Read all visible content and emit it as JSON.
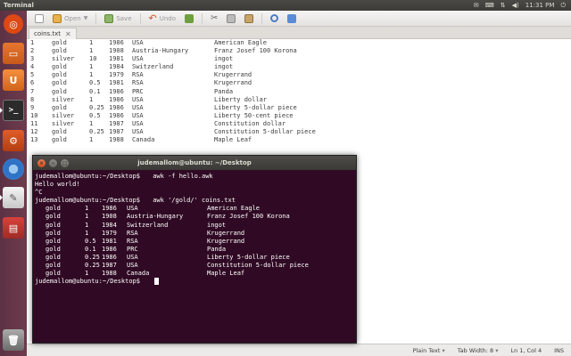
{
  "top_panel": {
    "app_title": "Terminal",
    "time": "11:31 PM"
  },
  "launcher": {
    "items": [
      "ubuntu-icon",
      "files-icon",
      "ubuntu-one-icon",
      "terminal-icon",
      "settings-icon",
      "chromium-icon",
      "gedit-icon",
      "impress-icon",
      "trash-icon"
    ]
  },
  "toolbar": {
    "open_label": "Open",
    "save_label": "Save",
    "undo_label": "Undo"
  },
  "tab": {
    "label": "coins.txt"
  },
  "editor_lines": [
    [
      "1",
      "gold",
      "1",
      "1986",
      "USA",
      "American Eagle"
    ],
    [
      "2",
      "gold",
      "1",
      "1908",
      "Austria-Hungary",
      "Franz Josef 100 Korona"
    ],
    [
      "3",
      "silver",
      "10",
      "1981",
      "USA",
      "ingot"
    ],
    [
      "4",
      "gold",
      "1",
      "1984",
      "Switzerland",
      "ingot"
    ],
    [
      "5",
      "gold",
      "1",
      "1979",
      "RSA",
      "Krugerrand"
    ],
    [
      "6",
      "gold",
      "0.5",
      "1981",
      "RSA",
      "Krugerrand"
    ],
    [
      "7",
      "gold",
      "0.1",
      "1986",
      "PRC",
      "Panda"
    ],
    [
      "8",
      "silver",
      "1",
      "1986",
      "USA",
      "Liberty dollar"
    ],
    [
      "9",
      "gold",
      "0.25",
      "1986",
      "USA",
      "Liberty 5-dollar piece"
    ],
    [
      "10",
      "silver",
      "0.5",
      "1986",
      "USA",
      "Liberty 50-cent piece"
    ],
    [
      "11",
      "silver",
      "1",
      "1987",
      "USA",
      "Constitution dollar"
    ],
    [
      "12",
      "gold",
      "0.25",
      "1987",
      "USA",
      "Constitution 5-dollar piece"
    ],
    [
      "13",
      "gold",
      "1",
      "1988",
      "Canada",
      "Maple Leaf"
    ]
  ],
  "statusbar": {
    "language": "Plain Text",
    "tab_width": "Tab Width: 8",
    "position": "Ln 1, Col 4",
    "mode": "INS"
  },
  "terminal": {
    "title": "judemallom@ubuntu: ~/Desktop",
    "prompt": "judemallom@ubuntu:~/Desktop$",
    "cmd1": " awk -f hello.awk",
    "out1": "Hello world!",
    "out2": "^C",
    "cmd2": " awk '/gold/' coins.txt",
    "results": [
      [
        "gold",
        "1",
        "1986",
        "USA",
        "American Eagle"
      ],
      [
        "gold",
        "1",
        "1908",
        "Austria-Hungary",
        "Franz Josef 100 Korona"
      ],
      [
        "gold",
        "1",
        "1984",
        "Switzerland",
        "ingot"
      ],
      [
        "gold",
        "1",
        "1979",
        "RSA",
        "Krugerrand"
      ],
      [
        "gold",
        "0.5",
        "1981",
        "RSA",
        "Krugerrand"
      ],
      [
        "gold",
        "0.1",
        "1986",
        "PRC",
        "Panda"
      ],
      [
        "gold",
        "0.25",
        "1986",
        "USA",
        "Liberty 5-dollar piece"
      ],
      [
        "gold",
        "0.25",
        "1987",
        "USA",
        "Constitution 5-dollar piece"
      ],
      [
        "gold",
        "1",
        "1988",
        "Canada",
        "Maple Leaf"
      ]
    ]
  },
  "colors": {
    "terminal_bg": "#300a24",
    "launcher_bg": "#5c3144",
    "panel_bg": "#3c3b37",
    "accent": "#dd4814"
  }
}
